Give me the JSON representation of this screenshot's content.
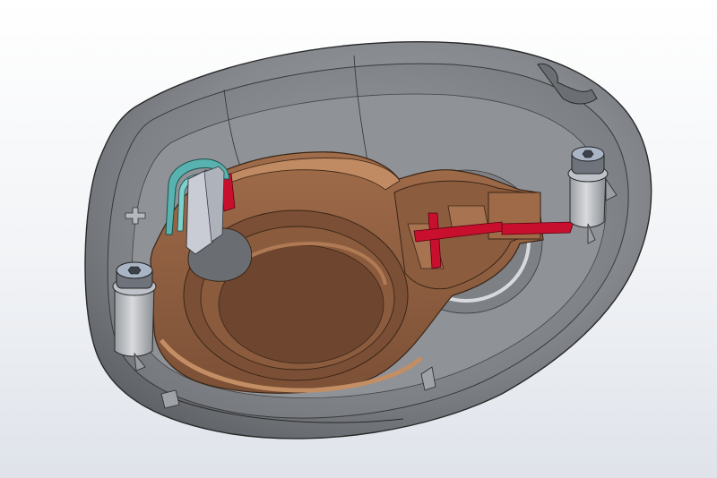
{
  "scene": {
    "kind": "cad-section-view",
    "colors": {
      "background_top": "#ffffff",
      "background_bottom": "#dfe3ea",
      "housing": "#8c8f94",
      "housing_dark": "#55585d",
      "housing_light": "#bfc2c6",
      "carrier": "#8a5a3c",
      "carrier_light": "#b17a55",
      "carrier_dark": "#5e3b25",
      "section_cut": "#c8102e",
      "clip_teal": "#58b3b0",
      "post_grey": "#c9ccd4",
      "screw_steel": "#6f747c",
      "screw_highlight": "#a9b4c4",
      "edge_line": "#222222"
    },
    "components": [
      {
        "id": "housing",
        "icon": "oval-housing-shell"
      },
      {
        "id": "carrier",
        "icon": "brown-carrier-plate"
      },
      {
        "id": "section-cuts",
        "icon": "red-section-cut"
      },
      {
        "id": "spring-clip",
        "icon": "teal-spring-clip"
      },
      {
        "id": "screws",
        "icon": "hex-socket-screw",
        "count": 2
      },
      {
        "id": "bosses",
        "icon": "cylindrical-boss",
        "count": 2
      }
    ]
  }
}
